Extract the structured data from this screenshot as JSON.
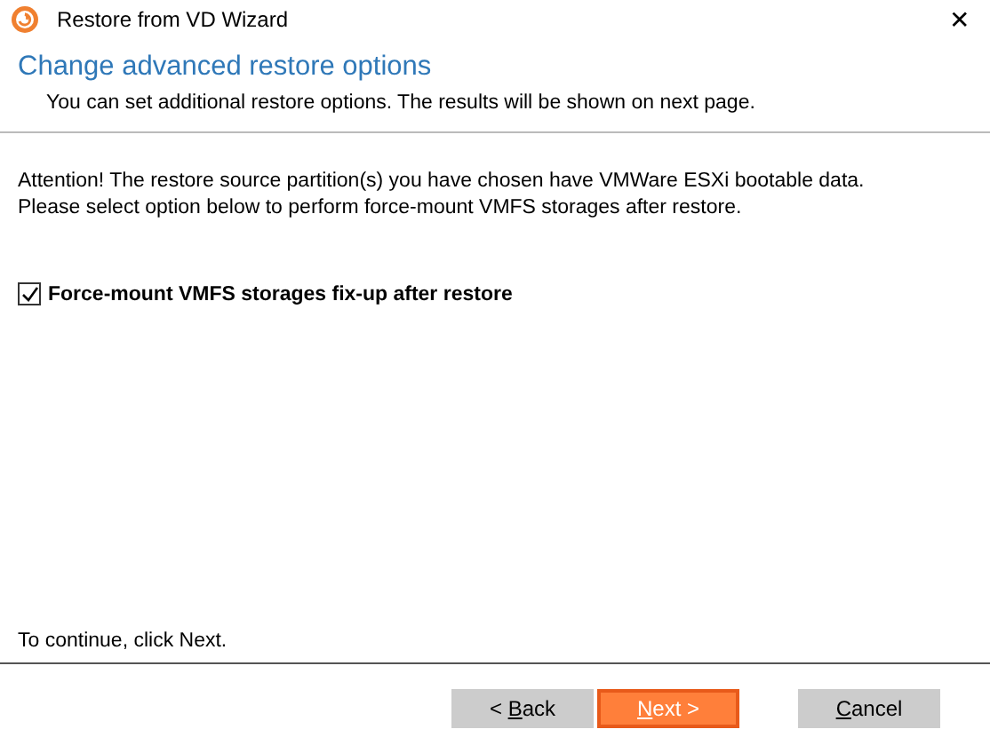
{
  "window": {
    "title": "Restore from VD Wizard",
    "close": "✕"
  },
  "header": {
    "title": "Change advanced restore options",
    "subtitle": "You can set additional restore options. The results will be shown on next page."
  },
  "message": [
    "Attention! The restore source partition(s) you have chosen have VMWare ESXi bootable data.",
    "Please select option below to perform force-mount VMFS storages after restore."
  ],
  "option": {
    "label": "Force-mount VMFS storages fix-up after restore",
    "checked": true
  },
  "hint": "To continue, click Next.",
  "buttons": [
    {
      "kind": "normal",
      "prefix": "< ",
      "mnemonic": "B",
      "suffix": "ack"
    },
    {
      "kind": "default",
      "mnemonic": "N",
      "suffix": "ext >"
    },
    {
      "kind": "normal",
      "mnemonic": "C",
      "suffix": "ancel"
    }
  ]
}
